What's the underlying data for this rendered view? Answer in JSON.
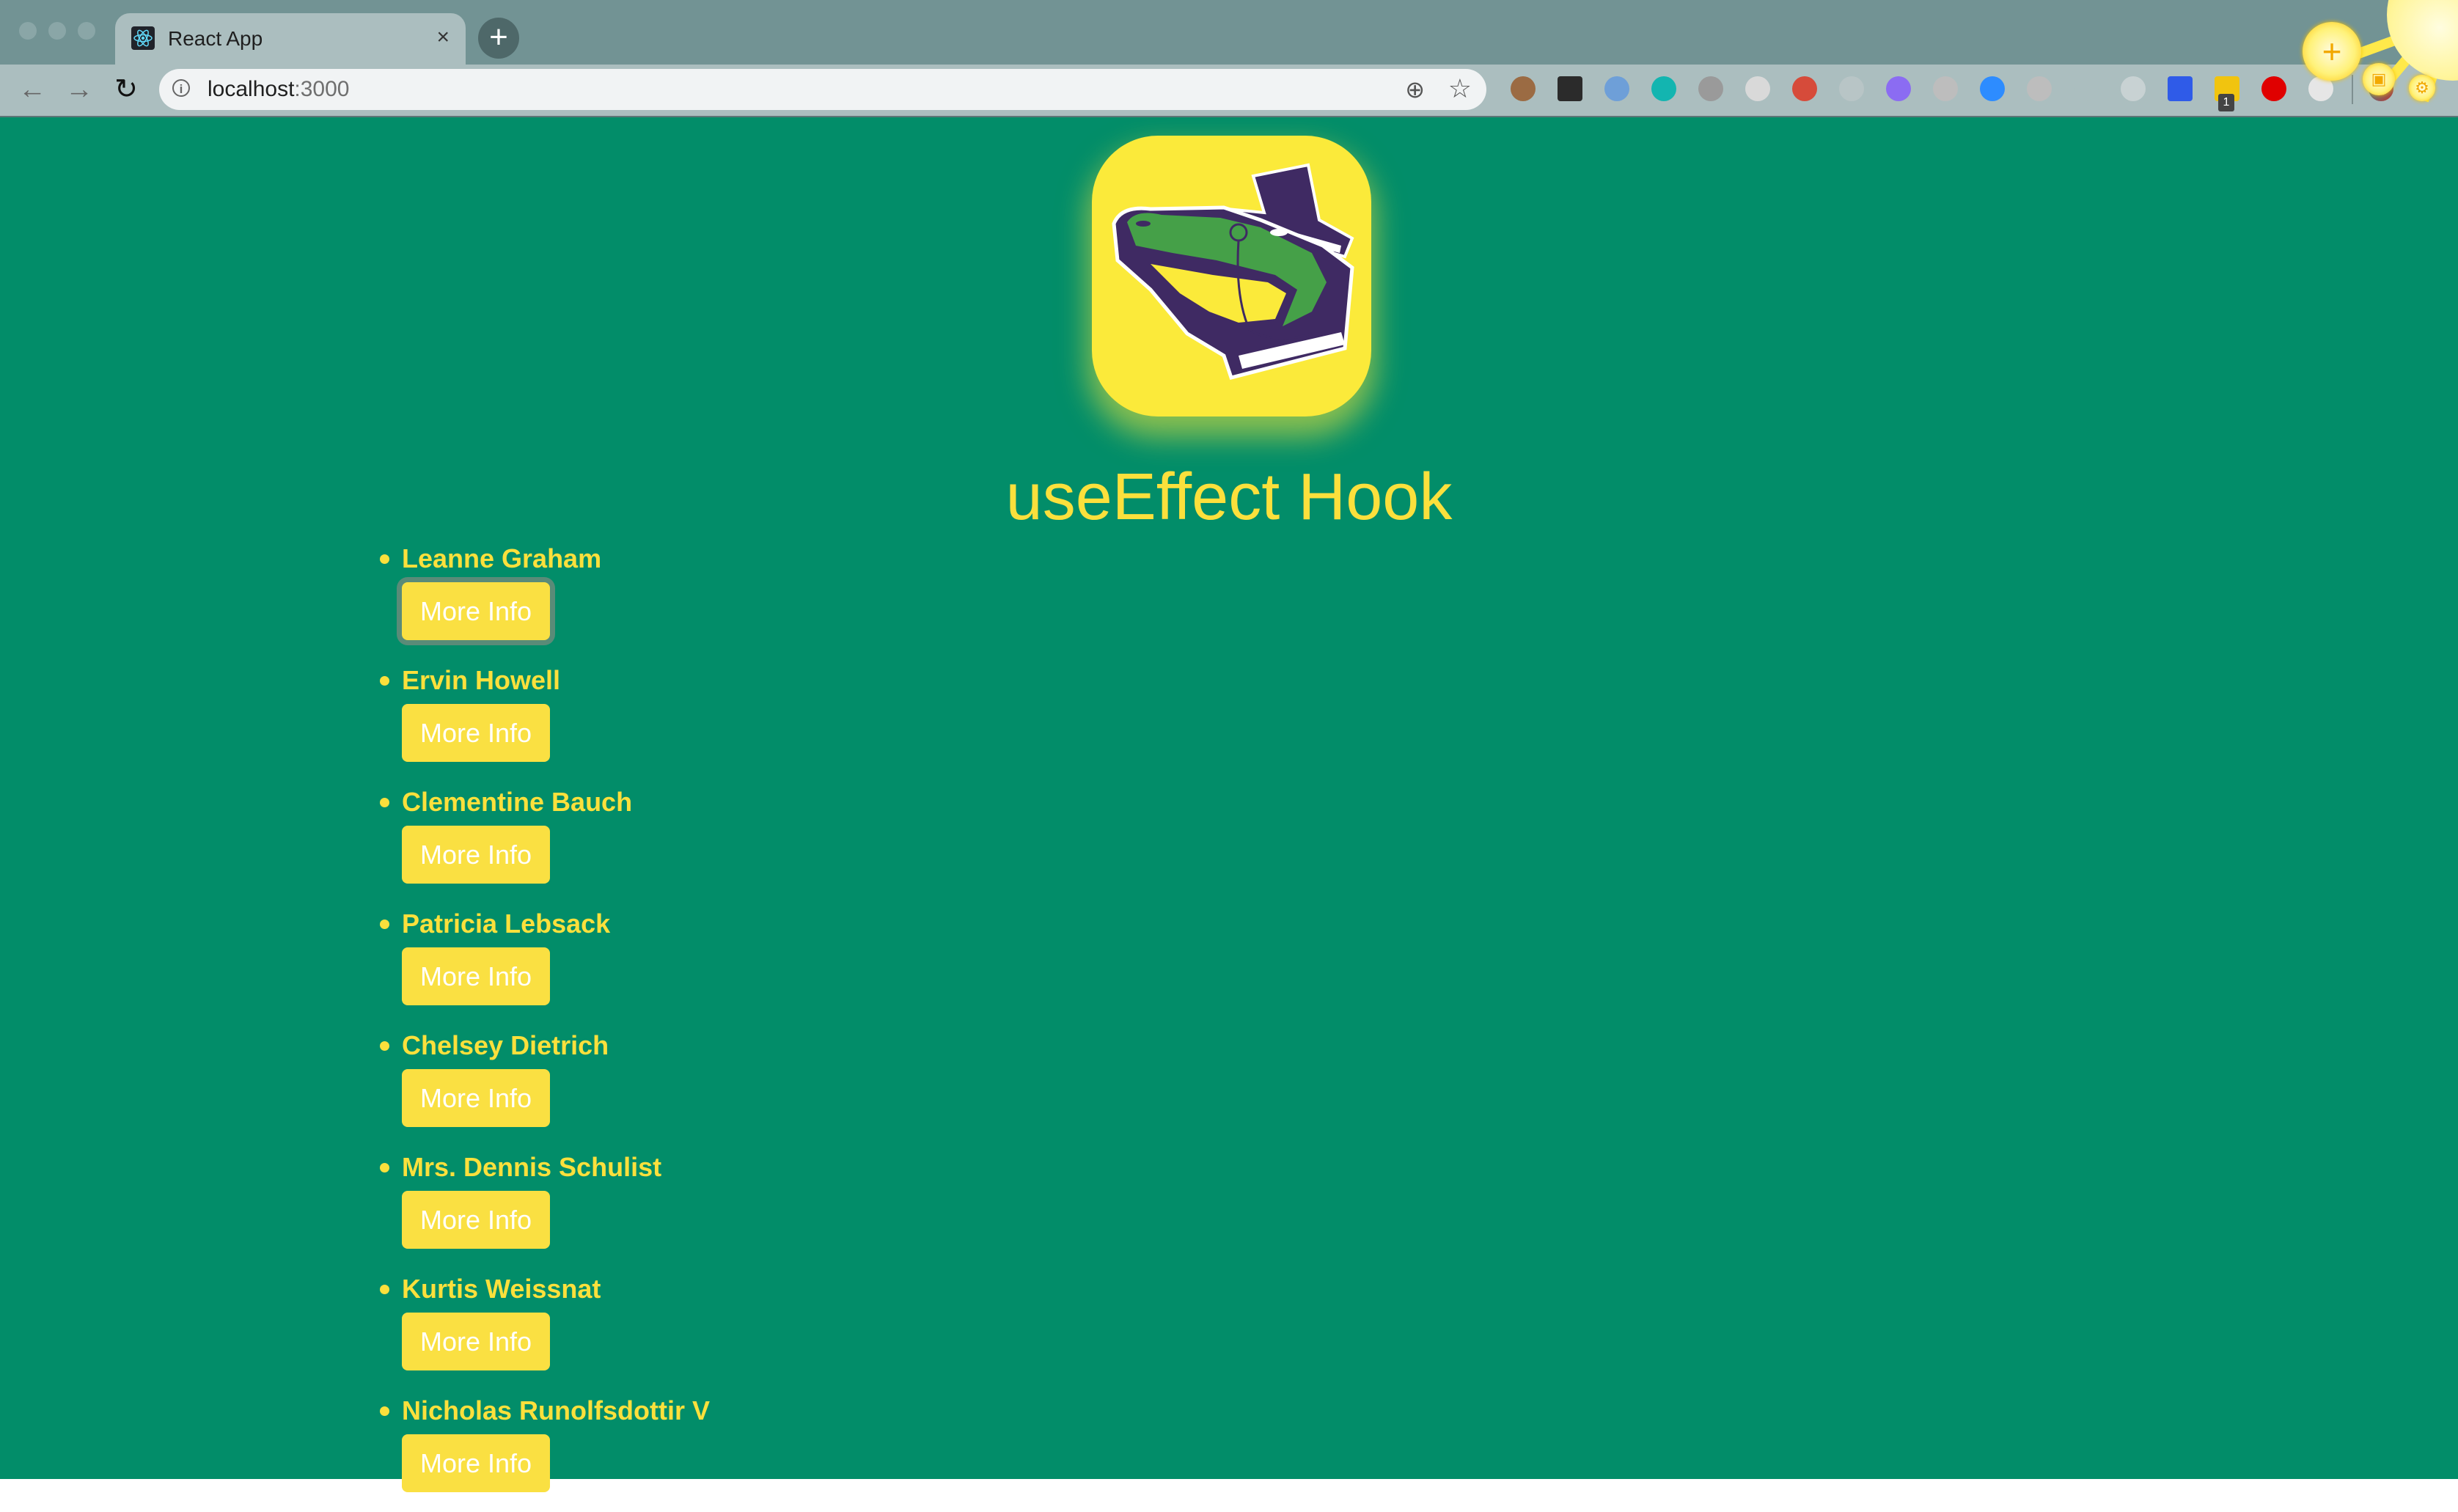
{
  "browser": {
    "tab_title": "React App",
    "tab_favicon": "react-atom-icon",
    "new_tab_label": "+",
    "close_tab_label": "×",
    "url_host": "localhost",
    "url_port": ":3000",
    "extensions": [
      {
        "name": "cookie-extension-icon",
        "color": "#9b6b43"
      },
      {
        "name": "green-dot-extension-icon",
        "color": "#2b2b2b"
      },
      {
        "name": "json-viewer-extension-icon",
        "color": "#6e9fd8"
      },
      {
        "name": "m-extension-icon",
        "color": "#13b5b0"
      },
      {
        "name": "command-extension-icon",
        "color": "#9a9a9a"
      },
      {
        "name": "dark-mode-extension-icon",
        "color": "#d9d9d9"
      },
      {
        "name": "react-devtools-extension-icon",
        "color": "#d64b3a"
      },
      {
        "name": "disabled-extension-icon",
        "color": "#b8c5c6"
      },
      {
        "name": "eye-extension-icon",
        "color": "#8b6cf2"
      },
      {
        "name": "gray-circle-extension-icon",
        "color": "#bdbdbd"
      },
      {
        "name": "zoom-extension-icon",
        "color": "#2d8cff"
      },
      {
        "name": "outlet-extension-icon",
        "color": "#bdbdbd"
      },
      {
        "name": "airplane-extension-icon",
        "color": "#abbebf"
      },
      {
        "name": "orbit-extension-icon",
        "color": "#c8d2d3"
      },
      {
        "name": "lighthouse-extension-icon",
        "color": "#2f5be8"
      },
      {
        "name": "yellow-dots-extension-icon",
        "color": "#f1c40f"
      },
      {
        "name": "power-extension-icon",
        "color": "#e00000"
      },
      {
        "name": "ghost-extension-icon",
        "color": "#e6e6e6"
      }
    ],
    "extension_badge": "1"
  },
  "page": {
    "background": "#028d69",
    "accent": "#fbe03c",
    "logo_alt": "gator-in-top-hat-logo",
    "heading": "useEffect Hook",
    "button_label": "More Info",
    "users": [
      {
        "name": "Leanne Graham",
        "focused": true
      },
      {
        "name": "Ervin Howell",
        "focused": false
      },
      {
        "name": "Clementine Bauch",
        "focused": false
      },
      {
        "name": "Patricia Lebsack",
        "focused": false
      },
      {
        "name": "Chelsey Dietrich",
        "focused": false
      },
      {
        "name": "Mrs. Dennis Schulist",
        "focused": false
      },
      {
        "name": "Kurtis Weissnat",
        "focused": false
      },
      {
        "name": "Nicholas Runolfsdottir V",
        "focused": false
      }
    ]
  }
}
